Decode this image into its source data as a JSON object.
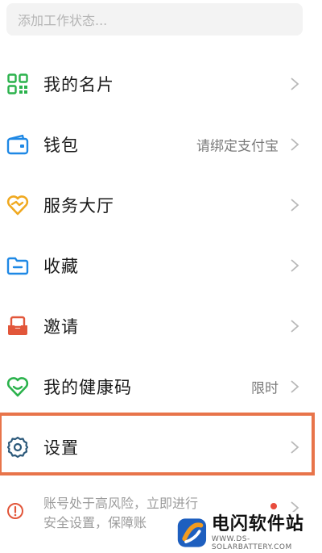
{
  "status_input": {
    "placeholder": "添加工作状态..."
  },
  "menu": [
    {
      "id": "card",
      "label": "我的名片",
      "value": "",
      "icon": "qr-code-icon",
      "color": "#2bb24c"
    },
    {
      "id": "wallet",
      "label": "钱包",
      "value": "请绑定支付宝",
      "icon": "wallet-icon",
      "color": "#1e88e5"
    },
    {
      "id": "services",
      "label": "服务大厅",
      "value": "",
      "icon": "heart-handshake-icon",
      "color": "#f0a920"
    },
    {
      "id": "favorites",
      "label": "收藏",
      "value": "",
      "icon": "folder-icon",
      "color": "#1e88e5"
    },
    {
      "id": "invite",
      "label": "邀请",
      "value": "",
      "icon": "invite-box-icon",
      "color": "#e2563a"
    },
    {
      "id": "health",
      "label": "我的健康码",
      "value": "限时",
      "icon": "health-heart-icon",
      "color": "#2bb24c"
    },
    {
      "id": "settings",
      "label": "设置",
      "value": "",
      "icon": "gear-icon",
      "color": "#2d5a7b"
    }
  ],
  "risk_notice": {
    "line1": "账号处于高风险，立即进行",
    "line2": "安全设置，保障账",
    "icon": "warning-icon",
    "color": "#e2563a"
  },
  "watermark": {
    "title": "电闪软件站",
    "subtitle": "WWW.DS-SOLARBATTERY.COM"
  }
}
